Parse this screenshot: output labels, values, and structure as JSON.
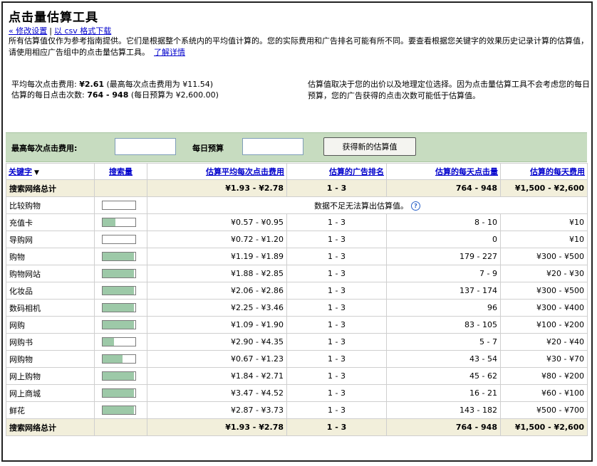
{
  "page": {
    "title": "点击量估算工具",
    "link_modify": "« 修改设置",
    "link_separator": "|",
    "link_csv": "以 csv 格式下载",
    "intro": "所有估算值仅作为参考指南提供。它们是根据整个系统内的平均值计算的。您的实际费用和广告排名可能有所不同。要查看根据您关键字的效果历史记录计算的估算值，请使用相应广告组中的点击量估算工具。",
    "learn_more": "了解详情"
  },
  "info": {
    "avg_cpc_label": "平均每次点击费用:",
    "avg_cpc_value": "¥2.61",
    "avg_cpc_note": "(最高每次点击费用为 ¥11.54)",
    "daily_clicks_label": "估算的每日点击次数:",
    "daily_clicks_value": "764 - 948",
    "daily_clicks_note": "(每日预算为 ¥2,600.00)",
    "right_note": "估算值取决于您的出价以及地理定位选择。因为点击量估算工具不会考虑您的每日预算，您的广告获得的点击次数可能低于估算值。"
  },
  "toolbar": {
    "max_cpc_label": "最高每次点击费用:",
    "max_cpc_value": "",
    "daily_budget_label": "每日预算",
    "daily_budget_value": "",
    "submit_label": "获得新的估算值"
  },
  "table": {
    "headers": {
      "keyword": "关键字",
      "search_volume": "搜索量",
      "est_avg_cpc": "估算平均每次点击费用",
      "est_ad_position": "估算的广告排名",
      "est_daily_clicks": "估算的每天点击量",
      "est_daily_cost": "估算的每天费用"
    },
    "total_label": "搜索网络总计",
    "total": {
      "cpc": "¥1.93 - ¥2.78",
      "position": "1 - 3",
      "clicks": "764 - 948",
      "cost": "¥1,500 - ¥2,600"
    },
    "no_data_note": "数据不足无法算出估算值。",
    "rows": [
      {
        "keyword": "比较购物",
        "volume": 0,
        "no_data": true
      },
      {
        "keyword": "充值卡",
        "volume": 0.4,
        "cpc": "¥0.57 - ¥0.95",
        "position": "1 - 3",
        "clicks": "8 - 10",
        "cost": "¥10"
      },
      {
        "keyword": "导购网",
        "volume": 0,
        "cpc": "¥0.72 - ¥1.20",
        "position": "1 - 3",
        "clicks": "0",
        "cost": "¥10"
      },
      {
        "keyword": "购物",
        "volume": 0.95,
        "cpc": "¥1.19 - ¥1.89",
        "position": "1 - 3",
        "clicks": "179 - 227",
        "cost": "¥300 - ¥500"
      },
      {
        "keyword": "购物网站",
        "volume": 0.95,
        "cpc": "¥1.88 - ¥2.85",
        "position": "1 - 3",
        "clicks": "7 - 9",
        "cost": "¥20 - ¥30"
      },
      {
        "keyword": "化妆品",
        "volume": 0.95,
        "cpc": "¥2.06 - ¥2.86",
        "position": "1 - 3",
        "clicks": "137 - 174",
        "cost": "¥300 - ¥500"
      },
      {
        "keyword": "数码相机",
        "volume": 0.95,
        "cpc": "¥2.25 - ¥3.46",
        "position": "1 - 3",
        "clicks": "96",
        "cost": "¥300 - ¥400"
      },
      {
        "keyword": "网购",
        "volume": 0.95,
        "cpc": "¥1.09 - ¥1.90",
        "position": "1 - 3",
        "clicks": "83 - 105",
        "cost": "¥100 - ¥200"
      },
      {
        "keyword": "网购书",
        "volume": 0.35,
        "cpc": "¥2.90 - ¥4.35",
        "position": "1 - 3",
        "clicks": "5 - 7",
        "cost": "¥20 - ¥40"
      },
      {
        "keyword": "网购物",
        "volume": 0.6,
        "cpc": "¥0.67 - ¥1.23",
        "position": "1 - 3",
        "clicks": "43 - 54",
        "cost": "¥30 - ¥70"
      },
      {
        "keyword": "网上购物",
        "volume": 0.95,
        "cpc": "¥1.84 - ¥2.71",
        "position": "1 - 3",
        "clicks": "45 - 62",
        "cost": "¥80 - ¥200"
      },
      {
        "keyword": "网上商城",
        "volume": 0.95,
        "cpc": "¥3.47 - ¥4.52",
        "position": "1 - 3",
        "clicks": "16 - 21",
        "cost": "¥60 - ¥100"
      },
      {
        "keyword": "鲜花",
        "volume": 0.95,
        "cpc": "¥2.87 - ¥3.73",
        "position": "1 - 3",
        "clicks": "143 - 182",
        "cost": "¥500 - ¥700"
      }
    ]
  }
}
